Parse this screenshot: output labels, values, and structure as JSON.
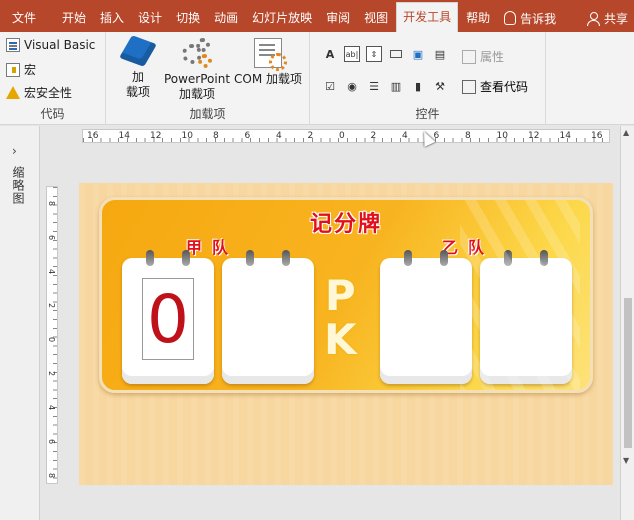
{
  "tabs": [
    {
      "label": "文件"
    },
    {
      "label": "开始"
    },
    {
      "label": "插入"
    },
    {
      "label": "设计"
    },
    {
      "label": "切换"
    },
    {
      "label": "动画"
    },
    {
      "label": "幻灯片放映"
    },
    {
      "label": "审阅"
    },
    {
      "label": "视图"
    },
    {
      "label": "开发工具"
    },
    {
      "label": "帮助"
    }
  ],
  "tell_me": "告诉我",
  "share": "共享",
  "ribbon": {
    "code": {
      "visual_basic": "Visual Basic",
      "macro": "宏",
      "macro_security": "宏安全性",
      "label": "代码"
    },
    "addins": {
      "addin_line1": "加",
      "addin_line2": "载项",
      "ppt_line1": "PowerPoint",
      "ppt_line2": "加载项",
      "com": "COM 加载项",
      "label": "加载项"
    },
    "controls": {
      "label": "控件",
      "properties": "属性",
      "view_code": "查看代码"
    }
  },
  "left_panel": {
    "label": "缩略图"
  },
  "ruler": {
    "h_labels": [
      "16",
      "14",
      "12",
      "10",
      "8",
      "6",
      "4",
      "2",
      "0",
      "2",
      "4",
      "6",
      "8",
      "10",
      "12",
      "14",
      "16"
    ],
    "v_labels": [
      "8",
      "6",
      "4",
      "2",
      "0",
      "2",
      "4",
      "6",
      "8"
    ]
  },
  "slide": {
    "title": "记分牌",
    "team_a": "甲队",
    "team_b": "乙队",
    "digit": "0",
    "vs_p": "P",
    "vs_k": "K"
  },
  "colors": {
    "tab_bar": "#b7472a",
    "title_red": "#e10f1b",
    "board_orange": "#f6a810"
  }
}
